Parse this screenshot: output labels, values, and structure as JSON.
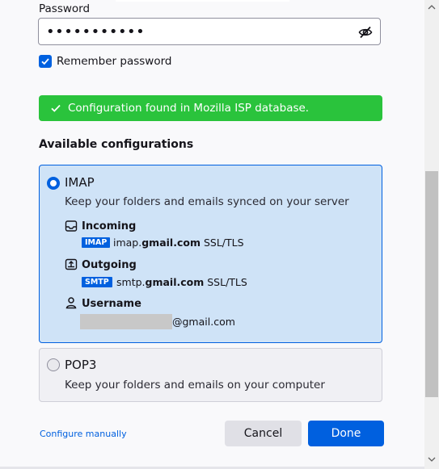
{
  "password": {
    "label": "Password",
    "value": "•••••••••••",
    "toggle_icon": "eye-slash-icon"
  },
  "remember": {
    "label": "Remember password",
    "checked": true
  },
  "notice": {
    "text": "Configuration found in Mozilla ISP database.",
    "color": "#2ac33c"
  },
  "configs": {
    "title": "Available configurations",
    "imap": {
      "title": "IMAP",
      "description": "Keep your folders and emails synced on your server",
      "selected": true,
      "incoming": {
        "label": "Incoming",
        "protocol": "IMAP",
        "host_prefix": "imap.",
        "host_domain": "gmail.com",
        "security": "SSL/TLS"
      },
      "outgoing": {
        "label": "Outgoing",
        "protocol": "SMTP",
        "host_prefix": "smtp.",
        "host_domain": "gmail.com",
        "security": "SSL/TLS"
      },
      "username": {
        "label": "Username",
        "suffix": "@gmail.com"
      }
    },
    "pop3": {
      "title": "POP3",
      "description": "Keep your folders and emails on your computer",
      "selected": false
    }
  },
  "footer": {
    "manual_link": "Configure manually",
    "cancel_label": "Cancel",
    "done_label": "Done"
  },
  "colors": {
    "accent": "#0060df",
    "selected_bg": "#cfe3f7"
  }
}
